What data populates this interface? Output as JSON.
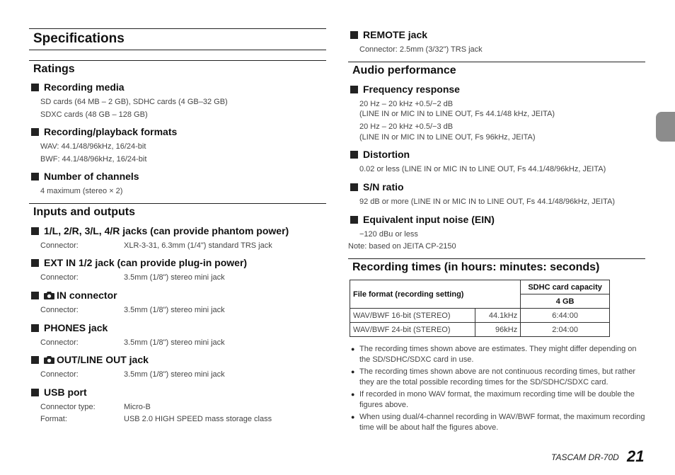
{
  "page": {
    "title": "Specifications",
    "footer_model": "TASCAM DR-70D",
    "footer_page": "21",
    "tab_color": "#8c8c8c"
  },
  "left": {
    "ratings": {
      "heading": "Ratings",
      "recording_media": {
        "title": "Recording media",
        "lines": [
          "SD cards (64 MB – 2 GB), SDHC cards (4 GB–32 GB)",
          "SDXC cards (48 GB – 128 GB)"
        ]
      },
      "formats": {
        "title": "Recording/playback formats",
        "lines": [
          "WAV: 44.1/48/96kHz, 16/24-bit",
          "BWF: 44.1/48/96kHz, 16/24-bit"
        ]
      },
      "channels": {
        "title": "Number of channels",
        "lines": [
          "4 maximum (stereo × 2)"
        ]
      }
    },
    "io": {
      "heading": "Inputs and outputs",
      "items": [
        {
          "title": "1/L, 2/R, 3/L, 4/R jacks (can provide phantom power)",
          "icon": "",
          "rows": [
            {
              "k": "Connector:",
              "v": "XLR-3-31, 6.3mm (1/4\") standard TRS jack"
            }
          ]
        },
        {
          "title": "EXT IN 1/2 jack (can provide plug-in power)",
          "icon": "",
          "rows": [
            {
              "k": "Connector:",
              "v": "3.5mm (1/8\") stereo mini jack"
            }
          ]
        },
        {
          "title": "IN connector",
          "icon": "camera-icon",
          "rows": [
            {
              "k": "Connector:",
              "v": "3.5mm (1/8\") stereo mini jack"
            }
          ]
        },
        {
          "title": "PHONES jack",
          "icon": "",
          "rows": [
            {
              "k": "Connector:",
              "v": "3.5mm (1/8\") stereo mini jack"
            }
          ]
        },
        {
          "title": "OUT/LINE OUT jack",
          "icon": "camera-icon",
          "rows": [
            {
              "k": "Connector:",
              "v": "3.5mm (1/8\") stereo mini jack"
            }
          ]
        },
        {
          "title": "USB port",
          "icon": "",
          "rows": [
            {
              "k": "Connector type:",
              "v": "Micro-B"
            },
            {
              "k": "Format:",
              "v": "USB 2.0 HIGH SPEED mass storage class"
            }
          ]
        }
      ]
    }
  },
  "right": {
    "remote": {
      "title": "REMOTE jack",
      "line": "Connector: 2.5mm (3/32\") TRS jack"
    },
    "audio": {
      "heading": "Audio performance",
      "freq": {
        "title": "Frequency response",
        "lines": [
          "20 Hz – 20 kHz +0.5/−2 dB",
          "(LINE IN or MIC IN to LINE OUT, Fs 44.1/48 kHz, JEITA)",
          "20 Hz – 20 kHz +0.5/−3 dB",
          "(LINE IN or MIC IN to LINE OUT, Fs 96kHz, JEITA)"
        ]
      },
      "distortion": {
        "title": "Distortion",
        "line": "0.02 or less (LINE IN or MIC IN to LINE OUT, Fs 44.1/48/96kHz, JEITA)"
      },
      "snr": {
        "title": "S/N ratio",
        "line": "92 dB or more (LINE IN or MIC IN to LINE OUT, Fs 44.1/48/96kHz, JEITA)"
      },
      "ein": {
        "title": "Equivalent input noise (EIN)",
        "line": "−120 dBu or less",
        "note": "Note: based on JEITA CP-2150"
      }
    },
    "rec_times": {
      "heading": "Recording times (in hours: minutes: seconds)",
      "table": {
        "col_header": "File format (recording setting)",
        "cap_header": "SDHC card capacity",
        "cap_size": "4 GB",
        "rows": [
          {
            "format": "WAV/BWF 16-bit (STEREO)",
            "rate": "44.1kHz",
            "time": "6:44:00"
          },
          {
            "format": "WAV/BWF 24-bit (STEREO)",
            "rate": "96kHz",
            "time": "2:04:00"
          }
        ]
      },
      "notes": [
        "The recording times shown above are estimates. They might differ depending on the SD/SDHC/SDXC card in use.",
        "The recording times shown above are not continuous recording times, but rather they are the total possible recording times for the SD/SDHC/SDXC card.",
        "If recorded in mono WAV format, the maximum recording time will be double the figures above.",
        "When using dual/4-channel recording in WAV/BWF format, the maximum recording time will be about half the figures above."
      ]
    }
  }
}
